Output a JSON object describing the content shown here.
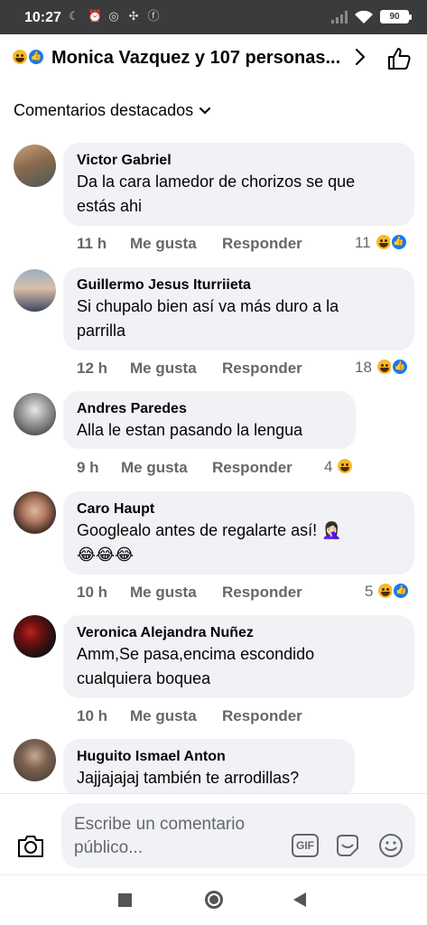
{
  "status_bar": {
    "time": "10:27",
    "battery": "90"
  },
  "header": {
    "title": "Monica Vazquez y 107 personas..."
  },
  "sort": {
    "label": "Comentarios destacados"
  },
  "actions": {
    "like": "Me gusta",
    "reply": "Responder"
  },
  "comments": [
    {
      "name": "Victor Gabriel",
      "line1": "Da la cara lamedor de chorizos se que",
      "line2": "estás ahi",
      "time": "11 h",
      "reactions": "11"
    },
    {
      "name": "Guillermo Jesus Iturriieta",
      "line1": "Si chupalo bien así va más duro a la",
      "line2": "parrilla",
      "time": "12 h",
      "reactions": "18"
    },
    {
      "name": "Andres Paredes",
      "line1": "Alla le estan pasando la lengua",
      "line2": "",
      "time": "9 h",
      "reactions": "4"
    },
    {
      "name": "Caro Haupt",
      "line1": "Googlealo antes de regalarte así! 🤦🏻‍♀️",
      "line2": "😂😂😂",
      "time": "10 h",
      "reactions": "5"
    },
    {
      "name": "Veronica Alejandra Nuñez",
      "line1": "Amm,Se pasa,encima escondido",
      "line2": "cualquiera boquea",
      "time": "10 h",
      "reactions": ""
    },
    {
      "name": "Huguito Ismael Anton",
      "line1": "Jajjajajaj también te arrodillas?",
      "line2": "",
      "time": "",
      "reactions": ""
    }
  ],
  "composer": {
    "placeholder": "Escribe un comentario público...",
    "gif_label": "GIF"
  },
  "colors": {
    "status_bar_bg": "#3a3b3c",
    "bubble_bg": "#f0f2f5",
    "secondary_text": "#65676b",
    "like_blue": "#1877f2",
    "haha_yellow": "#f7b928"
  },
  "icons": [
    "haha-reaction-icon",
    "like-reaction-icon",
    "chevron-right-icon",
    "thumbs-up-icon",
    "chevron-down-icon",
    "camera-icon",
    "gif-icon",
    "sticker-icon",
    "smile-icon"
  ]
}
